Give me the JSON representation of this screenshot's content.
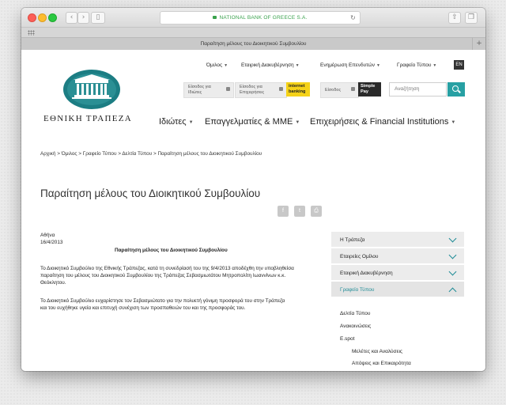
{
  "browser": {
    "url": "NATIONAL BANK OF GREECE S.A.",
    "tab_title": "Παραίτηση μέλους του Διοικητικού Συμβουλίου"
  },
  "header": {
    "logo_text": "ΕΘΝΙΚΗ ΤΡΑΠΕΖΑ",
    "top_nav": [
      "Όμιλος",
      "Εταιρική Διακυβέρνηση",
      "Ενημέρωση Επενδυτών",
      "Γραφείο Τύπου"
    ],
    "lang": "EN",
    "login_individuals": "Είσοδος για Ιδιώτες",
    "login_business": "Είσοδος για Επιχειρήσεις",
    "internet_banking": "internet banking",
    "login_simplepay": "Είσοδος",
    "simple_pay": "Simple Pay",
    "search_placeholder": "Αναζήτηση",
    "main_nav": [
      "Ιδιώτες",
      "Επαγγελματίες & ΜΜΕ",
      "Επιχειρήσεις & Financial Institutions"
    ]
  },
  "breadcrumb": "Αρχική > Όμιλος > Γραφείο Τύπου > Δελτία Τύπου > Παραίτηση μέλους του Διοικητικού Συμβουλίου",
  "page_title": "Παραίτηση μέλους του Διοικητικού Συμβουλίου",
  "article": {
    "place": "Αθήνα",
    "date": "16/4/2013",
    "heading": "Παραίτηση μέλους του Διοικητικού Συμβουλίου",
    "p1_l1": "Το Διοικητικό Συμβούλιο της Εθνικής Τράπεζας, κατά τη συνεδρίασή του της 9/4/2013 αποδέχθη την υποβληθείσα",
    "p1_l2": "παραίτηση του μέλους του Διοικητικού Συμβουλίου της Τράπεζας Σεβασμιωτάτου Μητροπολίτη Ιωαννίνων κ.κ.",
    "p1_l3": "Θεόκλητου.",
    "p2_l1": "Το Διοικητικό Συμβούλιο ευχαρίστησε τον Σεβασμιώτατο για την πολυετή γόνιμη προσφορά του στην Τράπεζα",
    "p2_l2": "και του ευχήθηκε υγεία και επιτυχή συνέχιση των προσπαθειών του και της προσφοράς του."
  },
  "sidebar": {
    "items": [
      "Η Τράπεζα",
      "Εταιρείες Ομίλου",
      "Εταιρική Διακυβέρνηση",
      "Γραφείο Τύπου"
    ],
    "sub": [
      "Δελτία Τύπου",
      "Ανακοινώσεις",
      "E.spot",
      "Μελέτες και Αναλύσεις",
      "Απόψεις και Επικαιρότητα"
    ]
  },
  "colors": {
    "accent": "#27a0a3",
    "ibank": "#f5d218"
  }
}
